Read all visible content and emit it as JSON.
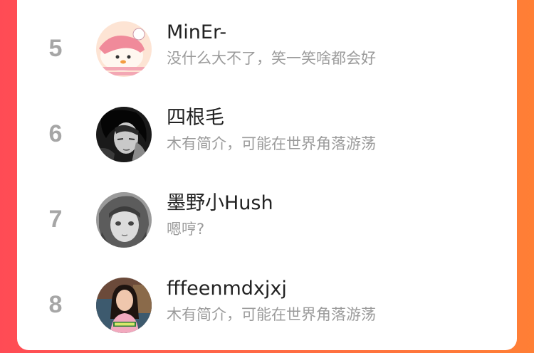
{
  "ranking": {
    "users": [
      {
        "rank": "5",
        "name": "MinEr-",
        "bio": "没什么大不了，笑一笑啥都会好",
        "avatar_icon": "cartoon-avatar-icon"
      },
      {
        "rank": "6",
        "name": "四根毛",
        "bio": "木有简介，可能在世界角落游荡",
        "avatar_icon": "bw-portrait-avatar-icon"
      },
      {
        "rank": "7",
        "name": "墨野小Hush",
        "bio": "嗯哼?",
        "avatar_icon": "anime-avatar-icon"
      },
      {
        "rank": "8",
        "name": "fffeenmdxjxj",
        "bio": "木有简介，可能在世界角落游荡",
        "avatar_icon": "photo-avatar-icon"
      }
    ]
  },
  "colors": {
    "background_gradient_start": "#ff4b55",
    "background_gradient_end": "#ff7f35",
    "rank_color": "#a6a6a6",
    "name_color": "#222222",
    "bio_color": "#9b9b9b"
  }
}
